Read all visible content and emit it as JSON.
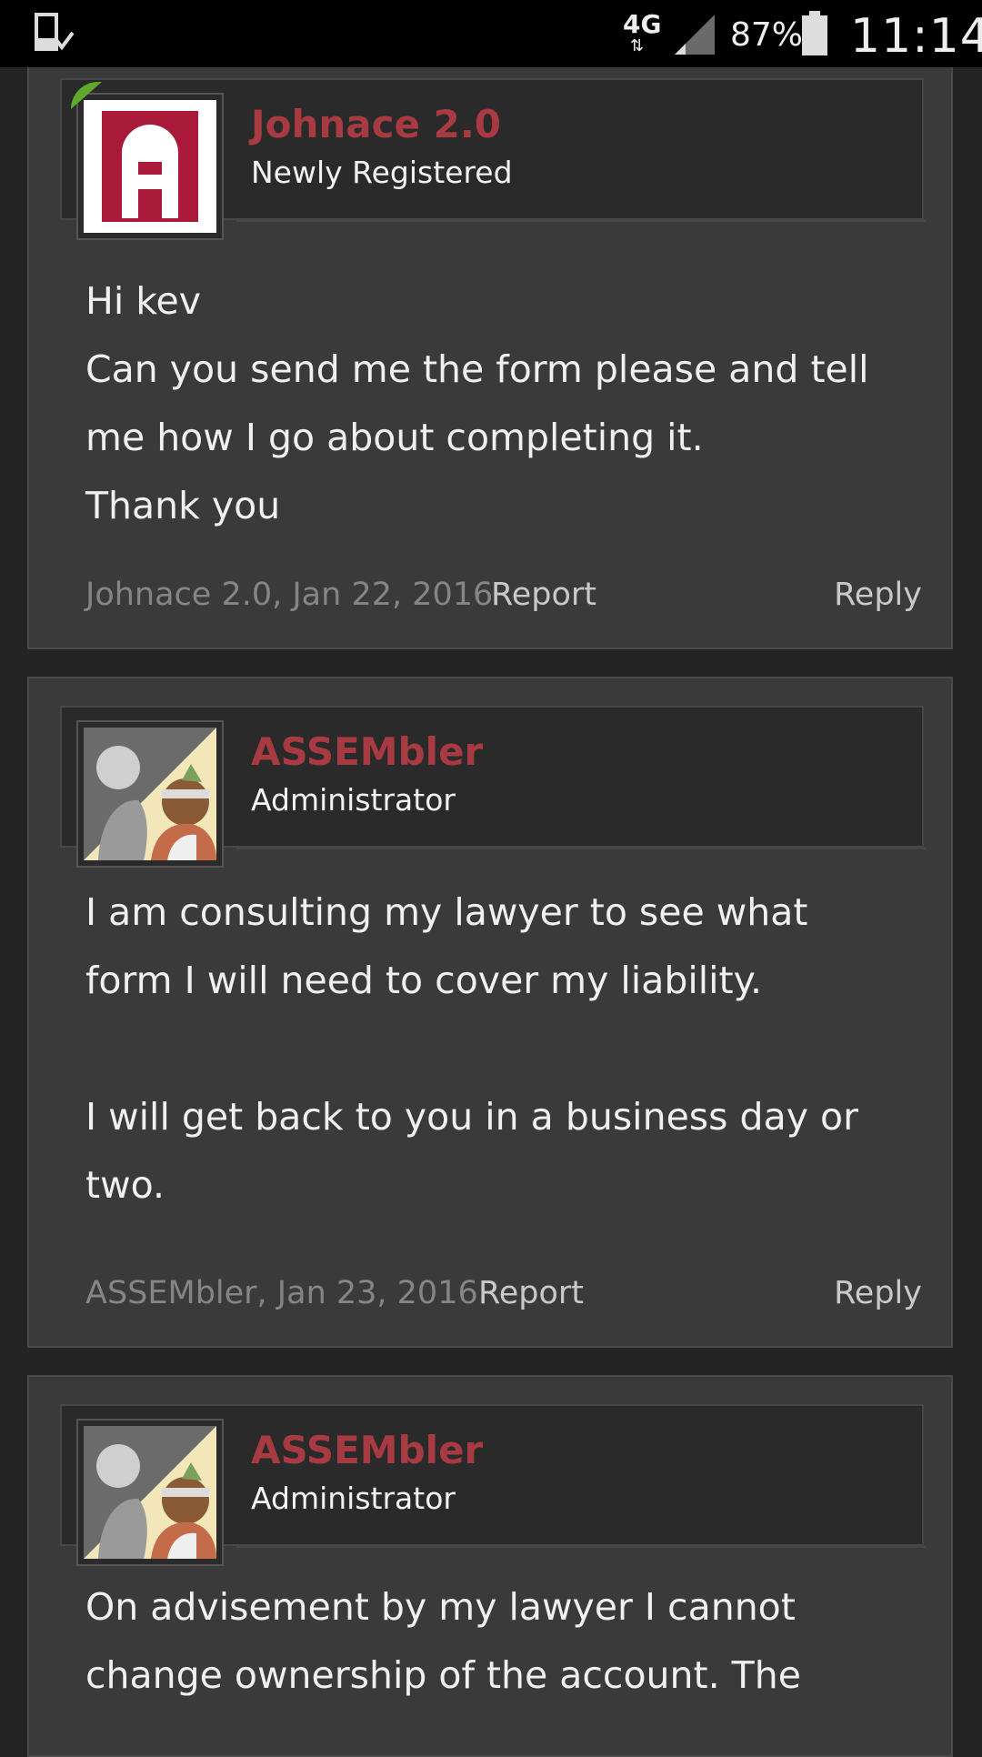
{
  "status_bar": {
    "network": "4G",
    "battery_percent": "87%",
    "time": "11:14",
    "icons": [
      "download-icon",
      "data-arrows-icon",
      "signal-icon",
      "battery-icon"
    ]
  },
  "posts": [
    {
      "username": "Johnace 2.0",
      "user_title": "Newly Registered",
      "avatar": "logo-a-avatar",
      "online": true,
      "body": "Hi kev\nCan you send me the form please and tell me how I go about completing it.\nThank you",
      "meta": "Johnace 2.0, Jan 22, 2016",
      "report_label": "Report",
      "reply_label": "Reply"
    },
    {
      "username": "ASSEMbler",
      "user_title": "Administrator",
      "avatar": "anime-characters-avatar",
      "online": false,
      "body": "I am consulting my lawyer to see what form I will need to cover my liability.\n\nI will get back to you in a business day or two.",
      "meta": "ASSEMbler, Jan 23, 2016",
      "report_label": "Report",
      "reply_label": "Reply"
    },
    {
      "username": "ASSEMbler",
      "user_title": "Administrator",
      "avatar": "anime-characters-avatar",
      "online": false,
      "body": "On advisement by my lawyer I cannot change ownership of the account. The"
    }
  ],
  "colors": {
    "background": "#242424",
    "post_background": "#3a3a3a",
    "header_background": "#2a2a2a",
    "username": "#a83a42",
    "online_badge": "#5ea82b"
  }
}
